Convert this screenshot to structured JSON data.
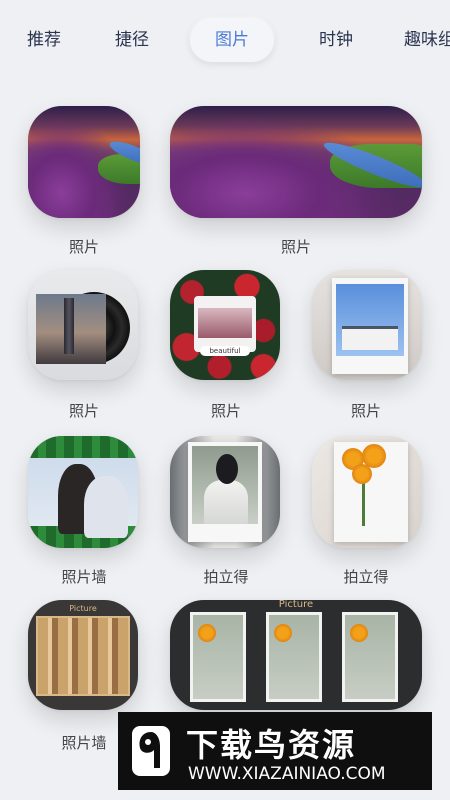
{
  "tabs": [
    "推荐",
    "捷径",
    "图片",
    "时钟",
    "趣味组件"
  ],
  "active_tab": "图片",
  "widgets": [
    {
      "label": "照片"
    },
    {
      "label": "照片"
    },
    {
      "label": "照片"
    },
    {
      "label": "照片"
    },
    {
      "label": "照片"
    },
    {
      "label": "照片墙"
    },
    {
      "label": "拍立得"
    },
    {
      "label": "拍立得"
    },
    {
      "label": "照片墙"
    }
  ],
  "rose_caption": "beautiful",
  "shelf_caption": "Picture",
  "strip_caption": "Picture",
  "watermark": {
    "title": "下载鸟资源",
    "url": "WWW.XIAZAINIAO.COM"
  }
}
